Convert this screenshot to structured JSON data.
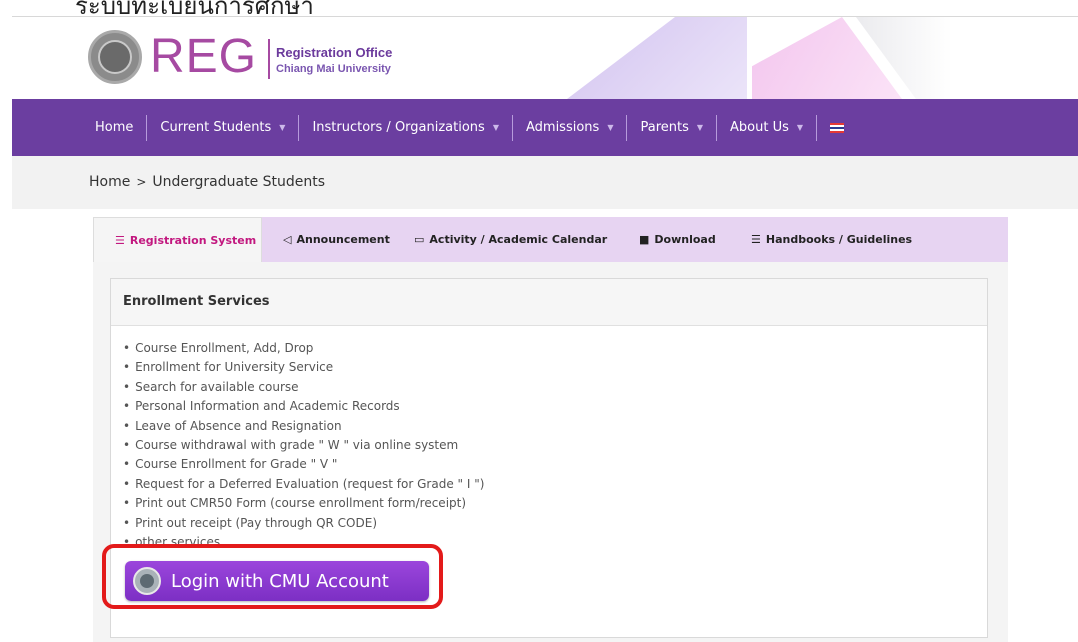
{
  "top_cut_text": "ระบบทะเบียนการศึกษา",
  "header": {
    "logo_text": "REG",
    "office": "Registration Office",
    "university": "Chiang Mai University"
  },
  "nav": {
    "items": [
      {
        "label": "Home"
      },
      {
        "label": "Current Students"
      },
      {
        "label": "Instructors / Organizations"
      },
      {
        "label": "Admissions"
      },
      {
        "label": "Parents"
      },
      {
        "label": "About Us"
      }
    ],
    "language_flag": "thai-flag"
  },
  "breadcrumb": {
    "home": "Home",
    "separator": ">",
    "current": "Undergraduate Students"
  },
  "tabs": [
    {
      "label": "Registration System",
      "icon": "database-icon",
      "active": true
    },
    {
      "label": "Announcement",
      "icon": "megaphone-icon",
      "active": false
    },
    {
      "label": "Activity / Academic Calendar",
      "icon": "calendar-icon",
      "active": false
    },
    {
      "label": "Download",
      "icon": "file-icon",
      "active": false
    },
    {
      "label": "Handbooks / Guidelines",
      "icon": "list-icon",
      "active": false
    }
  ],
  "panel": {
    "title": "Enrollment Services",
    "services": [
      "Course Enrollment, Add, Drop",
      "Enrollment for University Service",
      "Search for available course",
      "Personal Information and Academic Records",
      "Leave of Absence and Resignation",
      "Course withdrawal with grade \" W \" via online system",
      "Course Enrollment for Grade \" V \"",
      "Request for a Deferred Evaluation (request for Grade \" I \")",
      "Print out CMR50 Form (course enrollment form/receipt)",
      "Print out receipt (Pay through QR CODE)",
      "other services"
    ],
    "login_button": "Login with CMU Account"
  },
  "colors": {
    "navbar": "#6b3ea0",
    "tabs_bg": "#e7d4f2",
    "active_tab_text": "#c2187f",
    "login_button": "#8a3bd0",
    "highlight": "#e31a1a"
  }
}
